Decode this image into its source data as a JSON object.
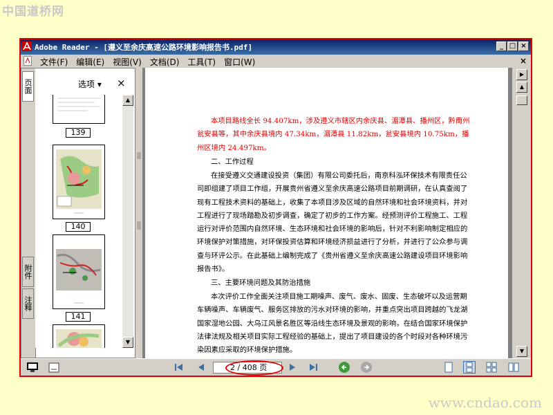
{
  "watermark_top": "中国道桥网",
  "watermark_bottom": "www.cndao.com",
  "window": {
    "title": "Adobe Reader - [遵义至余庆高速公路环境影响报告书.pdf]",
    "controls": [
      "_",
      "□",
      "×"
    ]
  },
  "menu": {
    "items": [
      "文件(F)",
      "编辑(E)",
      "视图(V)",
      "文档(D)",
      "工具(T)",
      "窗口(W)"
    ],
    "close": "×"
  },
  "nav_panel": {
    "tabs": [
      "页面",
      "附件",
      "注释"
    ],
    "options_label": "选项 ▾",
    "close": "×",
    "thumbnails": [
      {
        "page": "139"
      },
      {
        "page": "140"
      },
      {
        "page": "141"
      }
    ]
  },
  "document": {
    "paragraphs": [
      {
        "text": "本项目路线全长 94.407km，涉及遵义市辖区内余庆县、湄潭县、播州区，黔南州瓮安县等，其中余庆县境内 47.34km，湄潭县 11.82km，瓮安县境内 10.75km，播州区境内 24.497km。",
        "color": "red"
      },
      {
        "text": "二、工作过程"
      },
      {
        "text": "在接受遵义交通建设投资（集团）有限公司委托后，南京科泓环保技术有限责任公司即组建了项目工作组，开展贵州省遵义至余庆高速公路项目前期调研，在认真查阅了现有工程技术资料的基础上，收集了本项目涉及区域的自然环境和社会环境资料，并对工程进行了现场踏勘及初步调查，确定了初步的工作方案。经预测评价工程施工、工程运行对评价范围内自然环境、生态环境和社会环境的影响后，针对不利影响制定相应的环境保护对策措施，对环保投资估算和环境经济损益进行了分析，并进行了公众参与调查与环评公示。在此基础上编制完成了《贵州省遵义至余庆高速公路建设项目环境影响报告书》。"
      },
      {
        "text": "三、主要环境问题及其防治措施"
      },
      {
        "text": "本次评价工作全面关注项目施工期噪声、废气、废水、固废、生态破坏以及运营期车辆噪声、车辆废气、服务区排放的污水对环境的影响，并重点突出项目跨越的飞龙湖国家湿地公园、大乌江风景名胜区等沿线生态环境及景观的影响，在结合国家环境保护法律法规及相关项目实际工程经验的基础上，提出了项目建设的各个时段对各种环境污染因素应采取的环境保护措施。"
      }
    ]
  },
  "status": {
    "page_current": "2",
    "page_display": "2 / 408 页",
    "page_total": "408",
    "zoom_level": null
  },
  "colors": {
    "highlight": "#e00000",
    "titlebar": "#0a246a",
    "background": "#ffffc8"
  }
}
